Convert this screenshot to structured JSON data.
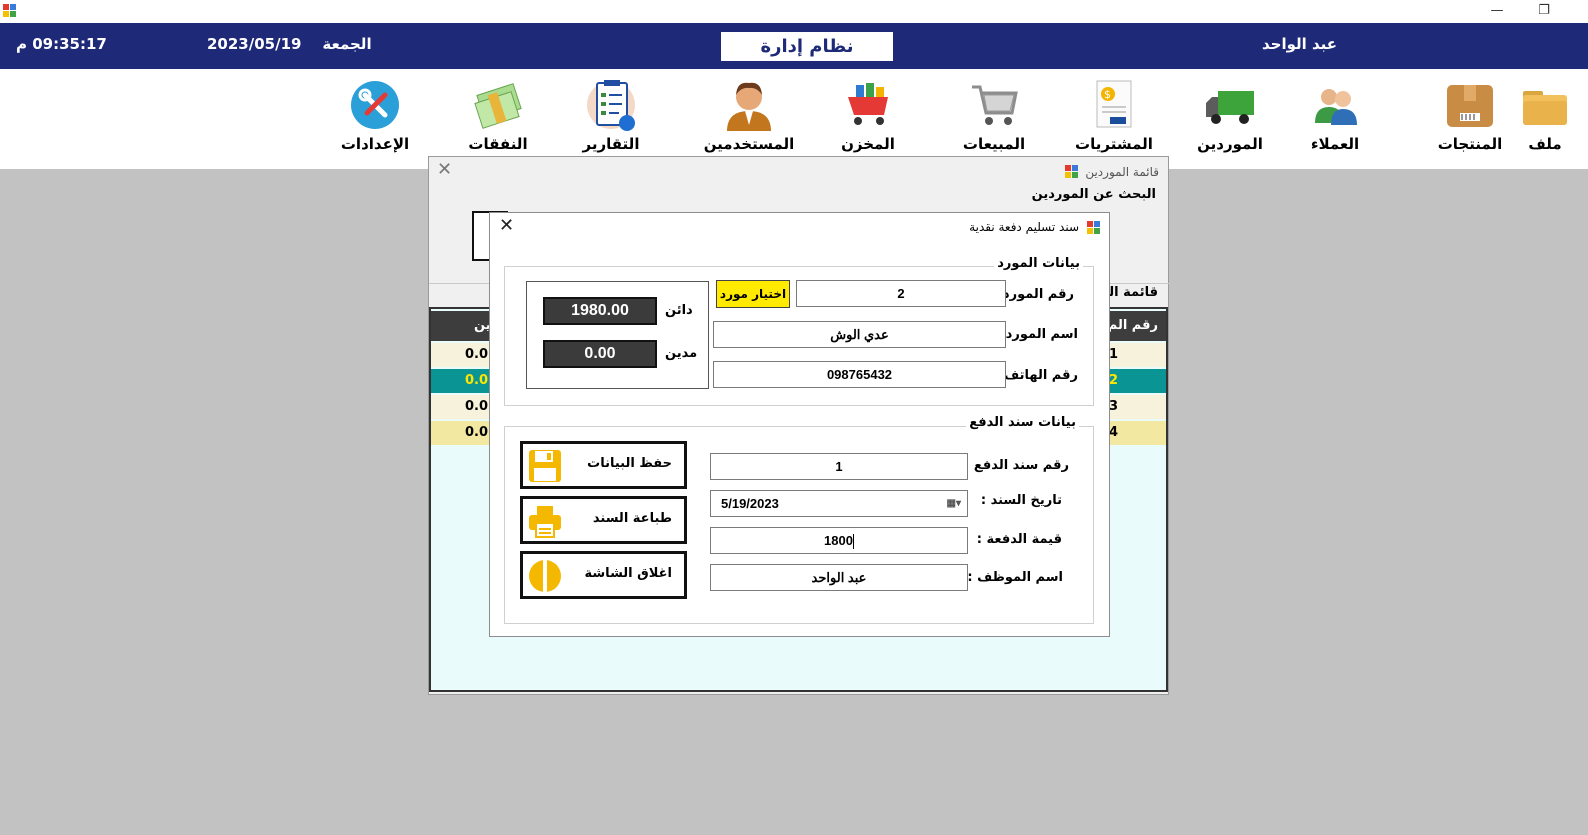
{
  "window": {
    "minimize_glyph": "—",
    "restore_glyph": "❐"
  },
  "header": {
    "time": "09:35:17 م",
    "day": "الجمعة",
    "date": "2023/05/19",
    "title": "نظام إدارة المبيعات",
    "user": "عبد الواحد",
    "accent": "#1e2a78"
  },
  "toolbar": {
    "items": [
      {
        "label": "ملف",
        "icon": "folder-icon"
      },
      {
        "label": "المنتجات",
        "icon": "box-icon"
      },
      {
        "label": "العملاء",
        "icon": "customers-icon"
      },
      {
        "label": "الموردين",
        "icon": "truck-icon"
      },
      {
        "label": "المشتريات",
        "icon": "invoice-icon"
      },
      {
        "label": "المبيعات",
        "icon": "cart-icon"
      },
      {
        "label": "المخزن",
        "icon": "store-cart-icon"
      },
      {
        "label": "المستخدمين",
        "icon": "user-icon"
      },
      {
        "label": "التقارير",
        "icon": "clipboard-icon"
      },
      {
        "label": "النفقات",
        "icon": "money-icon"
      },
      {
        "label": "الإعدادات",
        "icon": "settings-icon"
      }
    ]
  },
  "suppliers_list": {
    "title": "قائمة الموردين",
    "close": "✕",
    "search_label": "البحث عن الموردين",
    "list_label": "قائمة المو",
    "columns": {
      "number": "رقم الم",
      "balance": "ين"
    },
    "rows": [
      {
        "number": "1",
        "balance": "0.0"
      },
      {
        "number": "2",
        "balance": "0.0"
      },
      {
        "number": "3",
        "balance": "0.0"
      },
      {
        "number": "4",
        "balance": "0.0"
      }
    ]
  },
  "receipt": {
    "title": "سند تسليم دفعة نقدية",
    "close": "✕",
    "supplier_group": {
      "label": "بيانات المورد",
      "number_label": "رقم المورد :",
      "number_value": "2",
      "choose_button": "اختيار مورد",
      "name_label": "اسم المورد :",
      "name_value": "عدي الوش",
      "phone_label": "رقم الهاتف :",
      "phone_value": "098765432",
      "credit_label": "دائن",
      "credit_value": "1980.00",
      "debit_label": "مدين",
      "debit_value": "0.00"
    },
    "payment_group": {
      "label": "بيانات سند الدفع",
      "voucher_no_label": "رقم سند الدفع :",
      "voucher_no_value": "1",
      "date_label": "تاريخ السند :",
      "date_value": "5/19/2023",
      "amount_label": "قيمة الدفعة :",
      "amount_value": "1800",
      "employee_label": "اسم الموظف :",
      "employee_value": "عبد الواحد"
    },
    "buttons": {
      "save": "حفظ البيانات",
      "print": "طباعة السند",
      "close": "اغلاق الشاشة"
    },
    "icon_color": "#f5b800"
  }
}
